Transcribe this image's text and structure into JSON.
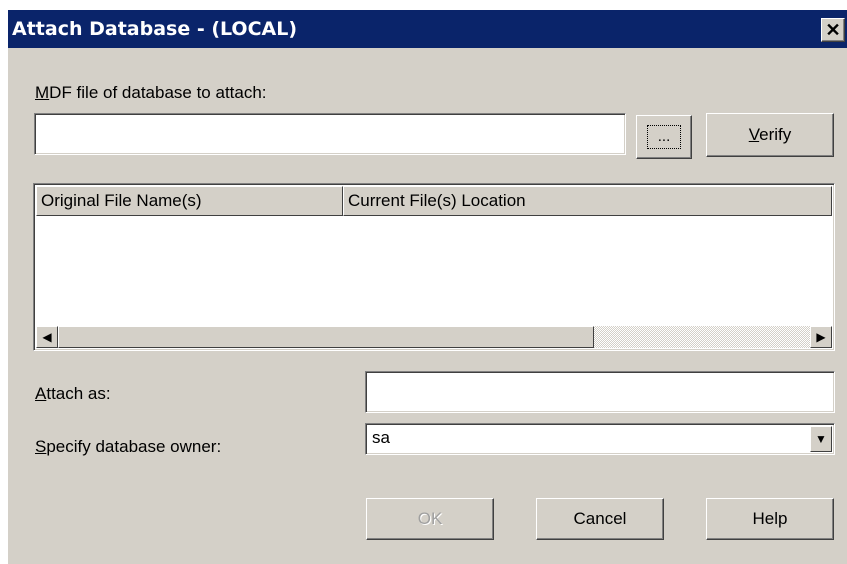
{
  "window": {
    "title": "Attach Database - (LOCAL)",
    "close_glyph": "✕"
  },
  "mdf": {
    "label_accel": "M",
    "label_rest": "DF file of database to attach:",
    "value": "",
    "browse_label": "...",
    "verify_accel": "V",
    "verify_rest": "erify"
  },
  "file_list": {
    "columns": [
      "Original File Name(s)",
      "Current File(s) Location"
    ],
    "rows": [],
    "scroll_left_glyph": "◀",
    "scroll_right_glyph": "▶"
  },
  "attach_as": {
    "label_accel": "A",
    "label_rest": "ttach as:",
    "value": ""
  },
  "owner": {
    "label_accel": "S",
    "label_rest": "pecify database owner:",
    "value": "sa",
    "arrow_glyph": "▼"
  },
  "buttons": {
    "ok": "OK",
    "cancel": "Cancel",
    "help": "Help"
  },
  "icons": {
    "close": "close-icon",
    "browse": "ellipsis-icon",
    "scroll_left": "arrow-left-icon",
    "scroll_right": "arrow-right-icon",
    "dropdown": "chevron-down-icon"
  }
}
